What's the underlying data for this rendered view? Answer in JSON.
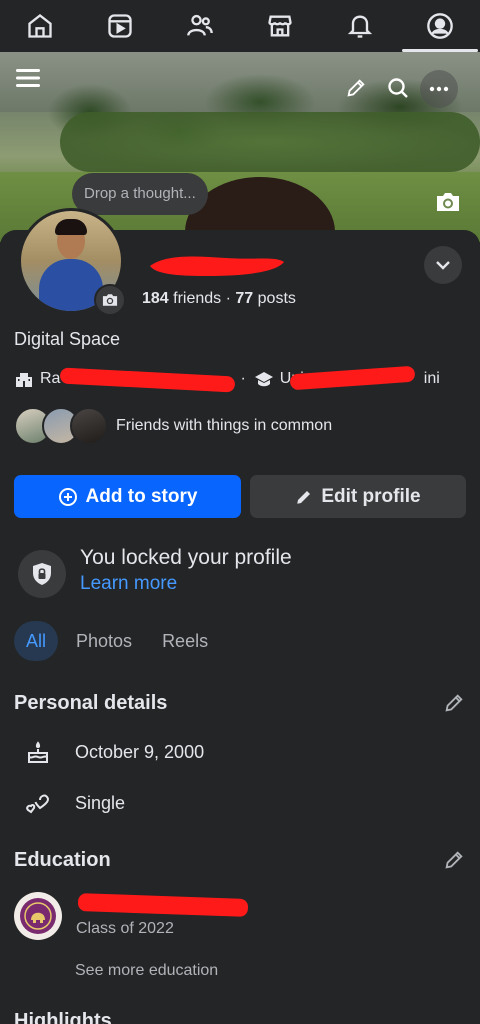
{
  "nav": {
    "items": [
      {
        "name": "home",
        "icon": "home-icon"
      },
      {
        "name": "video",
        "icon": "video-icon"
      },
      {
        "name": "friends",
        "icon": "friends-icon"
      },
      {
        "name": "marketplace",
        "icon": "marketplace-icon"
      },
      {
        "name": "notifications",
        "icon": "bell-icon"
      },
      {
        "name": "profile",
        "icon": "profile-icon",
        "active": true
      }
    ]
  },
  "cover": {
    "icons": [
      "menu-icon",
      "pencil-icon",
      "search-icon",
      "more-icon",
      "camera-icon"
    ]
  },
  "profile": {
    "thought_prompt": "Drop a thought...",
    "friends_count": "184",
    "friends_label": "friends",
    "separator": " · ",
    "posts_count": "77",
    "posts_label": "posts",
    "bio": "Digital Space",
    "workplace_visible": "Ra",
    "workplace_fragment": "·",
    "education_visible": "Uni",
    "education_tail": "ini",
    "mutual_text": "Friends with things in common"
  },
  "actions": {
    "add_story": "Add to story",
    "edit_profile": "Edit profile"
  },
  "lock": {
    "title": "You locked your profile",
    "link": "Learn more"
  },
  "tabs": [
    {
      "label": "All",
      "active": true
    },
    {
      "label": "Photos",
      "active": false
    },
    {
      "label": "Reels",
      "active": false
    }
  ],
  "personal_details": {
    "title": "Personal details",
    "birthday": "October 9, 2000",
    "relationship": "Single"
  },
  "education": {
    "title": "Education",
    "class_of": "Class of 2022",
    "see_more": "See more education"
  },
  "highlights": {
    "title": "Highlights"
  },
  "colors": {
    "background": "#242526",
    "accent": "#0866ff",
    "link": "#4599ff",
    "redaction": "#ff1a1a"
  }
}
